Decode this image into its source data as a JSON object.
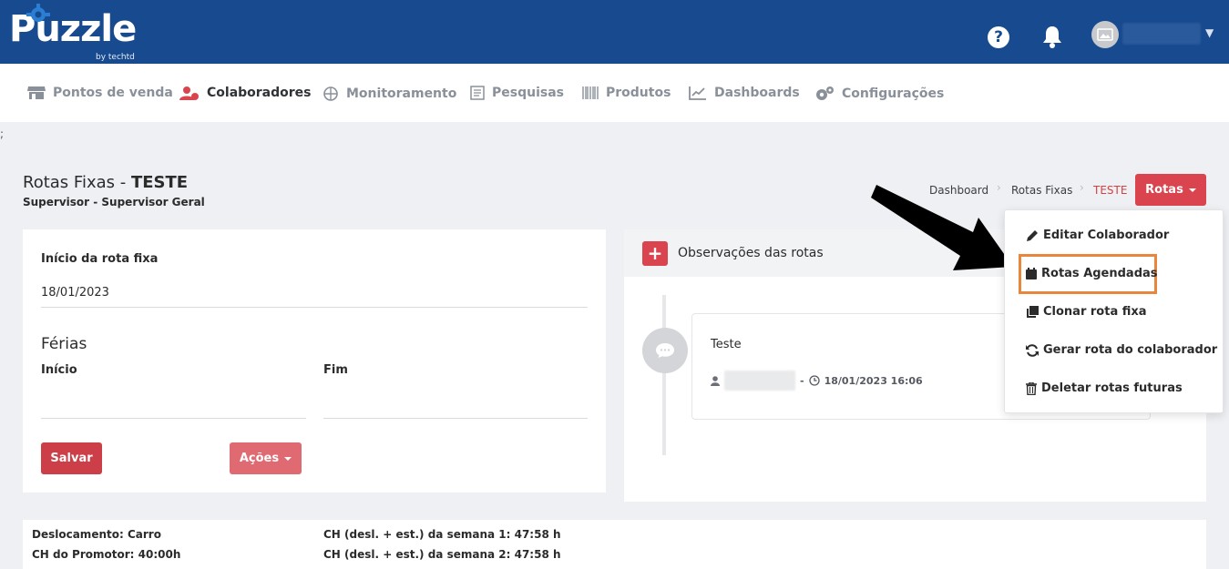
{
  "app": {
    "logo_text": "Puzzle",
    "logo_sub": "by techtd"
  },
  "topbar": {
    "help_icon": "question-circle-icon",
    "bell_icon": "bell-icon",
    "avatar_icon": "image-icon"
  },
  "nav": {
    "items": [
      {
        "label": "Pontos de venda",
        "icon": "store-icon"
      },
      {
        "label": "Colaboradores",
        "icon": "users-icon",
        "active": true
      },
      {
        "label": "Monitoramento",
        "icon": "globe-icon"
      },
      {
        "label": "Pesquisas",
        "icon": "survey-icon"
      },
      {
        "label": "Produtos",
        "icon": "barcode-icon"
      },
      {
        "label": "Dashboards",
        "icon": "chart-line-icon"
      },
      {
        "label": "Configurações",
        "icon": "gears-icon"
      }
    ]
  },
  "stray_text": ";",
  "header": {
    "title_prefix": "Rotas Fixas - ",
    "title_name": "TESTE",
    "subtitle": "Supervisor - Supervisor Geral"
  },
  "breadcrumb": {
    "items": [
      "Dashboard",
      "Rotas Fixas",
      "TESTE"
    ],
    "button_label": "Rotas"
  },
  "form": {
    "start_label": "Início da rota fixa",
    "start_value": "18/01/2023",
    "ferias_heading": "Férias",
    "inicio_label": "Início",
    "fim_label": "Fim",
    "save_label": "Salvar",
    "actions_label": "Ações"
  },
  "observations": {
    "title": "Observações das rotas",
    "note_text": "Teste",
    "note_meta": "- ⓘ 18/01/2023 16:06",
    "note_time": "18/01/2023 16:06"
  },
  "dropdown": {
    "items": [
      {
        "label": "Editar Colaborador",
        "icon": "pencil-icon"
      },
      {
        "label": "Rotas Agendadas",
        "icon": "calendar-icon",
        "highlighted": true
      },
      {
        "label": "Clonar rota fixa",
        "icon": "clone-icon"
      },
      {
        "label": "Gerar rota do colaborador",
        "icon": "refresh-icon"
      },
      {
        "label": "Deletar rotas futuras",
        "icon": "trash-icon"
      }
    ]
  },
  "bottom": {
    "deslocamento": "Deslocamento: Carro",
    "ch_promotor": "CH do Promotor: 40:00h",
    "ch_semana1": "CH (desl. + est.) da semana 1: 47:58 h",
    "ch_semana2": "CH (desl. + est.) da semana 2: 47:58 h"
  },
  "colors": {
    "brand_blue": "#174a8f",
    "accent_red": "#d9444f",
    "highlight_orange": "#e8863c"
  }
}
